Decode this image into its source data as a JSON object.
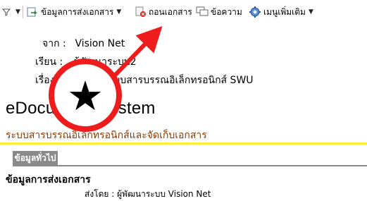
{
  "toolbar": {
    "filter_icon": "filter-icon",
    "send_info_label": "ข้อมูลการส่งเอกสาร",
    "recall_label": "ถอนเอกสาร",
    "message_label": "ข้อความ",
    "more_menu_label": "เมนูเพิ่มเติม"
  },
  "document": {
    "from_label": "จาก :",
    "from_value": "Vision Net",
    "to_label": "เรียน :",
    "to_value": "ผู้พัฒนาระบบ2",
    "subject_label": "เรื่อง :",
    "subject_value": "ระบบสารบรรณอิเล็กทรอนิกส์ SWU"
  },
  "app": {
    "title": "eDocument System",
    "subtitle": "ระบบสารบรรณอิเล็กทรอนิกส์และจัดเก็บเอกสาร"
  },
  "tabs": {
    "general_label": "ข้อมูลทั่วไป"
  },
  "section": {
    "title": "ข้อมูลการส่งเอกสาร",
    "sent_by_label": "ส่งโดย :",
    "sent_by_value": "ผู้พัฒนาระบบ Vision Net"
  },
  "annotation": {
    "marker_symbol": "★",
    "arrow_color": "#ee1c1c"
  },
  "colors": {
    "subtitle": "#8b3a00",
    "rule_yellow": "#ffee33",
    "tab_gray": "#8a8a8a"
  }
}
